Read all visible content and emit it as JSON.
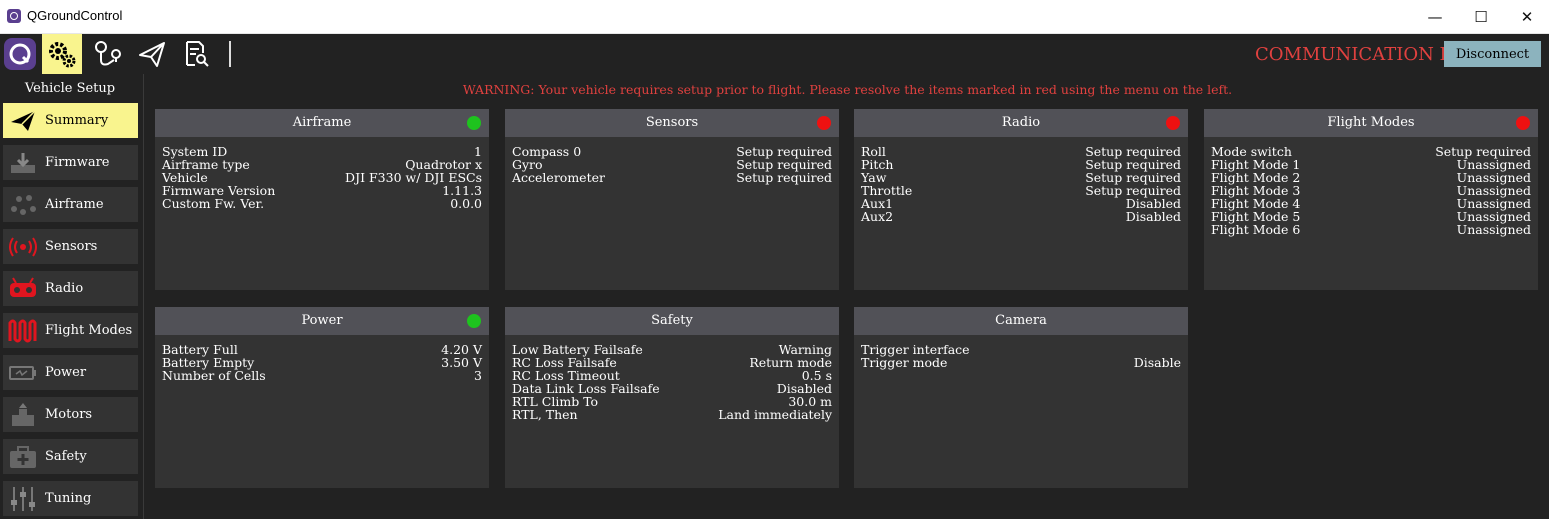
{
  "window": {
    "title": "QGroundControl",
    "minimize_label": "—",
    "maximize_label": "☐",
    "close_label": "✕"
  },
  "toolbar": {
    "icons": [
      "app-logo-icon",
      "gears-icon",
      "plan-route-icon",
      "paper-plane-icon",
      "analyze-icon"
    ],
    "status": "COMMUNICATION LOST",
    "disconnect_label": "Disconnect"
  },
  "colors": {
    "accent": "#f9f48e",
    "ok": "#1ec31e",
    "error": "#ee1111",
    "warning_text": "#e0413f",
    "panel": "#333333",
    "panel_header": "#515157"
  },
  "sidebar": {
    "title": "Vehicle Setup",
    "items": [
      {
        "label": "Summary",
        "icon": "paper-plane-icon",
        "active": true
      },
      {
        "label": "Firmware",
        "icon": "download-icon",
        "active": false
      },
      {
        "label": "Airframe",
        "icon": "airframe-icon",
        "active": false
      },
      {
        "label": "Sensors",
        "icon": "sensors-icon",
        "active": false
      },
      {
        "label": "Radio",
        "icon": "radio-icon",
        "active": false
      },
      {
        "label": "Flight Modes",
        "icon": "flight-modes-icon",
        "active": false
      },
      {
        "label": "Power",
        "icon": "battery-icon",
        "active": false
      },
      {
        "label": "Motors",
        "icon": "motors-icon",
        "active": false
      },
      {
        "label": "Safety",
        "icon": "safety-icon",
        "active": false
      },
      {
        "label": "Tuning",
        "icon": "sliders-icon",
        "active": false
      }
    ]
  },
  "warning": "WARNING: Your vehicle requires setup prior to flight. Please resolve the items marked in red using the menu on the left.",
  "cards": {
    "airframe": {
      "title": "Airframe",
      "status": "ok",
      "rows": [
        {
          "k": "System ID",
          "v": "1"
        },
        {
          "k": "Airframe type",
          "v": "Quadrotor x"
        },
        {
          "k": "Vehicle",
          "v": "DJI F330 w/ DJI ESCs"
        },
        {
          "k": "Firmware Version",
          "v": "1.11.3"
        },
        {
          "k": "Custom Fw. Ver.",
          "v": "0.0.0"
        }
      ]
    },
    "sensors": {
      "title": "Sensors",
      "status": "error",
      "rows": [
        {
          "k": "Compass 0",
          "v": "Setup required"
        },
        {
          "k": "Gyro",
          "v": "Setup required"
        },
        {
          "k": "Accelerometer",
          "v": "Setup required"
        }
      ]
    },
    "radio": {
      "title": "Radio",
      "status": "error",
      "rows": [
        {
          "k": "Roll",
          "v": "Setup required"
        },
        {
          "k": "Pitch",
          "v": "Setup required"
        },
        {
          "k": "Yaw",
          "v": "Setup required"
        },
        {
          "k": "Throttle",
          "v": "Setup required"
        },
        {
          "k": "Aux1",
          "v": "Disabled"
        },
        {
          "k": "Aux2",
          "v": "Disabled"
        }
      ]
    },
    "flight_modes": {
      "title": "Flight Modes",
      "status": "error",
      "rows": [
        {
          "k": "Mode switch",
          "v": "Setup required"
        },
        {
          "k": "Flight Mode 1",
          "v": "Unassigned"
        },
        {
          "k": "Flight Mode 2",
          "v": "Unassigned"
        },
        {
          "k": "Flight Mode 3",
          "v": "Unassigned"
        },
        {
          "k": "Flight Mode 4",
          "v": "Unassigned"
        },
        {
          "k": "Flight Mode 5",
          "v": "Unassigned"
        },
        {
          "k": "Flight Mode 6",
          "v": "Unassigned"
        }
      ]
    },
    "power": {
      "title": "Power",
      "status": "ok",
      "rows": [
        {
          "k": "Battery Full",
          "v": "4.20 V"
        },
        {
          "k": "Battery Empty",
          "v": "3.50 V"
        },
        {
          "k": "Number of Cells",
          "v": "3"
        }
      ]
    },
    "safety": {
      "title": "Safety",
      "status": "none",
      "rows": [
        {
          "k": "Low Battery Failsafe",
          "v": "Warning"
        },
        {
          "k": "RC Loss Failsafe",
          "v": "Return mode"
        },
        {
          "k": "RC Loss Timeout",
          "v": "0.5 s"
        },
        {
          "k": "Data Link Loss Failsafe",
          "v": "Disabled"
        },
        {
          "k": "RTL Climb To",
          "v": "30.0 m"
        },
        {
          "k": "RTL, Then",
          "v": "Land immediately"
        }
      ]
    },
    "camera": {
      "title": "Camera",
      "status": "none",
      "rows": [
        {
          "k": "Trigger interface",
          "v": ""
        },
        {
          "k": "Trigger mode",
          "v": "Disable"
        }
      ]
    }
  }
}
